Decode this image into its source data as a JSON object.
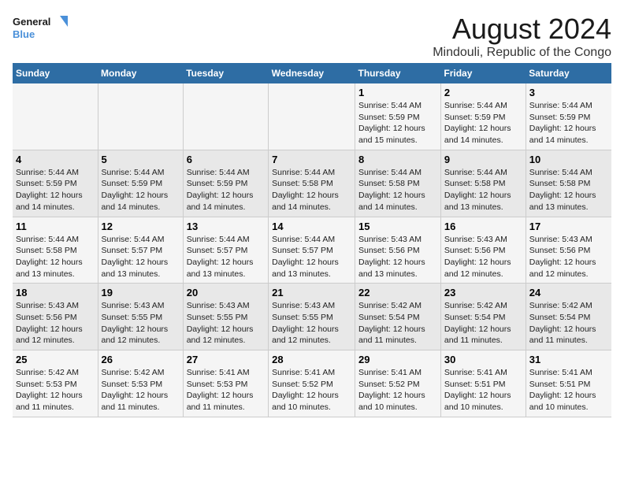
{
  "logo": {
    "line1": "General",
    "line2": "Blue"
  },
  "title": "August 2024",
  "location": "Mindouli, Republic of the Congo",
  "days_of_week": [
    "Sunday",
    "Monday",
    "Tuesday",
    "Wednesday",
    "Thursday",
    "Friday",
    "Saturday"
  ],
  "weeks": [
    [
      {
        "day": "",
        "info": ""
      },
      {
        "day": "",
        "info": ""
      },
      {
        "day": "",
        "info": ""
      },
      {
        "day": "",
        "info": ""
      },
      {
        "day": "1",
        "info": "Sunrise: 5:44 AM\nSunset: 5:59 PM\nDaylight: 12 hours\nand 15 minutes."
      },
      {
        "day": "2",
        "info": "Sunrise: 5:44 AM\nSunset: 5:59 PM\nDaylight: 12 hours\nand 14 minutes."
      },
      {
        "day": "3",
        "info": "Sunrise: 5:44 AM\nSunset: 5:59 PM\nDaylight: 12 hours\nand 14 minutes."
      }
    ],
    [
      {
        "day": "4",
        "info": "Sunrise: 5:44 AM\nSunset: 5:59 PM\nDaylight: 12 hours\nand 14 minutes."
      },
      {
        "day": "5",
        "info": "Sunrise: 5:44 AM\nSunset: 5:59 PM\nDaylight: 12 hours\nand 14 minutes."
      },
      {
        "day": "6",
        "info": "Sunrise: 5:44 AM\nSunset: 5:59 PM\nDaylight: 12 hours\nand 14 minutes."
      },
      {
        "day": "7",
        "info": "Sunrise: 5:44 AM\nSunset: 5:58 PM\nDaylight: 12 hours\nand 14 minutes."
      },
      {
        "day": "8",
        "info": "Sunrise: 5:44 AM\nSunset: 5:58 PM\nDaylight: 12 hours\nand 14 minutes."
      },
      {
        "day": "9",
        "info": "Sunrise: 5:44 AM\nSunset: 5:58 PM\nDaylight: 12 hours\nand 13 minutes."
      },
      {
        "day": "10",
        "info": "Sunrise: 5:44 AM\nSunset: 5:58 PM\nDaylight: 12 hours\nand 13 minutes."
      }
    ],
    [
      {
        "day": "11",
        "info": "Sunrise: 5:44 AM\nSunset: 5:58 PM\nDaylight: 12 hours\nand 13 minutes."
      },
      {
        "day": "12",
        "info": "Sunrise: 5:44 AM\nSunset: 5:57 PM\nDaylight: 12 hours\nand 13 minutes."
      },
      {
        "day": "13",
        "info": "Sunrise: 5:44 AM\nSunset: 5:57 PM\nDaylight: 12 hours\nand 13 minutes."
      },
      {
        "day": "14",
        "info": "Sunrise: 5:44 AM\nSunset: 5:57 PM\nDaylight: 12 hours\nand 13 minutes."
      },
      {
        "day": "15",
        "info": "Sunrise: 5:43 AM\nSunset: 5:56 PM\nDaylight: 12 hours\nand 13 minutes."
      },
      {
        "day": "16",
        "info": "Sunrise: 5:43 AM\nSunset: 5:56 PM\nDaylight: 12 hours\nand 12 minutes."
      },
      {
        "day": "17",
        "info": "Sunrise: 5:43 AM\nSunset: 5:56 PM\nDaylight: 12 hours\nand 12 minutes."
      }
    ],
    [
      {
        "day": "18",
        "info": "Sunrise: 5:43 AM\nSunset: 5:56 PM\nDaylight: 12 hours\nand 12 minutes."
      },
      {
        "day": "19",
        "info": "Sunrise: 5:43 AM\nSunset: 5:55 PM\nDaylight: 12 hours\nand 12 minutes."
      },
      {
        "day": "20",
        "info": "Sunrise: 5:43 AM\nSunset: 5:55 PM\nDaylight: 12 hours\nand 12 minutes."
      },
      {
        "day": "21",
        "info": "Sunrise: 5:43 AM\nSunset: 5:55 PM\nDaylight: 12 hours\nand 12 minutes."
      },
      {
        "day": "22",
        "info": "Sunrise: 5:42 AM\nSunset: 5:54 PM\nDaylight: 12 hours\nand 11 minutes."
      },
      {
        "day": "23",
        "info": "Sunrise: 5:42 AM\nSunset: 5:54 PM\nDaylight: 12 hours\nand 11 minutes."
      },
      {
        "day": "24",
        "info": "Sunrise: 5:42 AM\nSunset: 5:54 PM\nDaylight: 12 hours\nand 11 minutes."
      }
    ],
    [
      {
        "day": "25",
        "info": "Sunrise: 5:42 AM\nSunset: 5:53 PM\nDaylight: 12 hours\nand 11 minutes."
      },
      {
        "day": "26",
        "info": "Sunrise: 5:42 AM\nSunset: 5:53 PM\nDaylight: 12 hours\nand 11 minutes."
      },
      {
        "day": "27",
        "info": "Sunrise: 5:41 AM\nSunset: 5:53 PM\nDaylight: 12 hours\nand 11 minutes."
      },
      {
        "day": "28",
        "info": "Sunrise: 5:41 AM\nSunset: 5:52 PM\nDaylight: 12 hours\nand 10 minutes."
      },
      {
        "day": "29",
        "info": "Sunrise: 5:41 AM\nSunset: 5:52 PM\nDaylight: 12 hours\nand 10 minutes."
      },
      {
        "day": "30",
        "info": "Sunrise: 5:41 AM\nSunset: 5:51 PM\nDaylight: 12 hours\nand 10 minutes."
      },
      {
        "day": "31",
        "info": "Sunrise: 5:41 AM\nSunset: 5:51 PM\nDaylight: 12 hours\nand 10 minutes."
      }
    ]
  ]
}
